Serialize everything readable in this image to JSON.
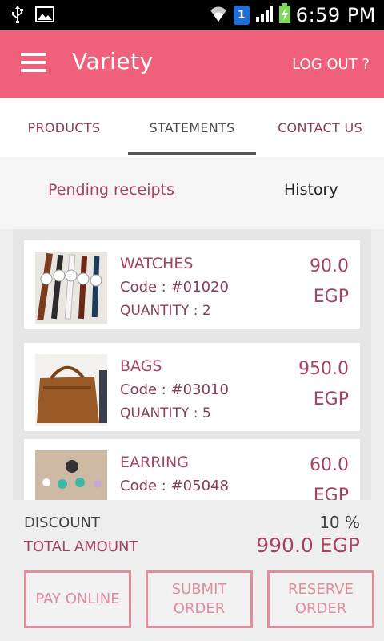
{
  "status_bar": {
    "time": "6:59 PM",
    "sim": "1"
  },
  "app_bar": {
    "title": "Variety",
    "logout": "LOG OUT ?"
  },
  "tabs": [
    {
      "label": "PRODUCTS"
    },
    {
      "label": "STATEMENTS"
    },
    {
      "label": "CONTACT US"
    }
  ],
  "sub_tabs": {
    "pending": "Pending receipts",
    "history": "History"
  },
  "items": [
    {
      "name": "WATCHES",
      "code": "Code : #01020",
      "quantity": "QUANTITY : 2",
      "price": "90.0",
      "currency": "EGP"
    },
    {
      "name": "BAGS",
      "code": "Code : #03010",
      "quantity": "QUANTITY : 5",
      "price": "950.0",
      "currency": "EGP"
    },
    {
      "name": "EARRING",
      "code": "Code : #05048",
      "quantity": "",
      "price": "60.0",
      "currency": "EGP"
    }
  ],
  "summary": {
    "discount_label": "DISCOUNT",
    "discount_value": "10 %",
    "total_label": "TOTAL AMOUNT",
    "total_value": "990.0 EGP"
  },
  "buttons": {
    "pay": "PAY ONLINE",
    "submit": "SUBMIT ORDER",
    "reserve": "RESERVE ORDER"
  },
  "colors": {
    "accent": "#f0607a",
    "text_accent": "#a6435f",
    "button_border": "#e08d9c"
  }
}
